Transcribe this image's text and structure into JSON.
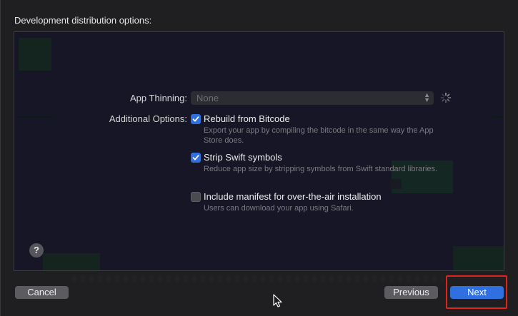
{
  "heading": "Development distribution options:",
  "app_thinning": {
    "label": "App Thinning:",
    "value": "None"
  },
  "additional_options": {
    "label": "Additional Options:",
    "items": [
      {
        "title": "Rebuild from Bitcode",
        "description": "Export your app by compiling the bitcode in the same way the App Store does.",
        "checked": true
      },
      {
        "title": "Strip Swift symbols",
        "description": "Reduce app size by stripping symbols from Swift standard libraries.",
        "checked": true
      },
      {
        "title": "Include manifest for over-the-air installation",
        "description": "Users can download your app using Safari.",
        "checked": false
      }
    ]
  },
  "help_label": "?",
  "buttons": {
    "cancel": "Cancel",
    "previous": "Previous",
    "next": "Next"
  },
  "colors": {
    "accent": "#2f6fe0",
    "highlight_box": "#e0241c"
  }
}
